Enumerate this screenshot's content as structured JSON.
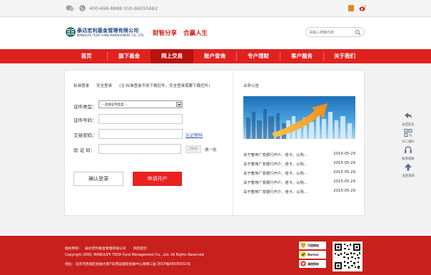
{
  "topbar": {
    "phone": "400-698-8888 010-66555662"
  },
  "header": {
    "logo_cn": "泰达宏利基金管理有限公司",
    "logo_en": "MANULIFE TEDA FUND MANAGEMENT CO., LTD.",
    "slogan_a": "财智分享",
    "slogan_b": "合赢人生",
    "search_placeholder": "请输入搜索内容"
  },
  "nav": {
    "items": [
      {
        "label": "首页"
      },
      {
        "label": "旗下基金"
      },
      {
        "label": "网上交易"
      },
      {
        "label": "账户查询"
      },
      {
        "label": "专户理财"
      },
      {
        "label": "客户服务"
      },
      {
        "label": "关于我们"
      }
    ],
    "active_index": 2
  },
  "login": {
    "tab_standard": "标准登录",
    "tab_secure": "安全登录",
    "note": "(注:标准登录不用下载控件，安全登录需要下载控件)",
    "id_type_label": "证件类型：",
    "id_type_value": "-- 选择证件类型 --",
    "id_number_label": "证件号码：",
    "password_label": "交易密码：",
    "forgot_label": "忘记密码",
    "captcha_label": "验  证 码：",
    "captcha_text": "7824",
    "captcha_refresh": "换一张",
    "confirm_button": "确认登录",
    "open_account_button": "申请开户"
  },
  "announcements": {
    "title": "业务公告",
    "items": [
      {
        "title": "关于暂停广发银行开户、增卡、认购...",
        "date": "2015-05-29"
      },
      {
        "title": "关于暂停广发银行开户、增卡、认购...",
        "date": "2015-05-29"
      },
      {
        "title": "关于暂停广发银行开户、增卡、认购...",
        "date": "2015-05-29"
      },
      {
        "title": "关于暂停广发银行开户、增卡、认购...",
        "date": "2015-05-29"
      },
      {
        "title": "关于暂停广发银行开户、增卡、认购...",
        "date": "2015-05-29"
      }
    ]
  },
  "float_toolbar": {
    "items": [
      {
        "label": "返回首页",
        "icon": "back-arrow-icon"
      },
      {
        "label": "扫二维码",
        "icon": "qrcode-icon"
      },
      {
        "label": "联系客服",
        "icon": "headset-icon"
      },
      {
        "label": "返回顶部",
        "icon": "arrow-up-icon"
      }
    ]
  },
  "footer": {
    "copyright_owner_label": "版权所有：",
    "copyright_owner": "泰达宏利基金管理有限公司",
    "risk_notice": "风险提示",
    "copyright_line": "Copyright 2000, MANULIFE TEDA Fund Management Co., Ltd. All Rights Reserved",
    "address_line": "地址：北京市西城区金融大街7号英蓝国际金融中心南楼三层  京ICP备06035032号",
    "badges": [
      {
        "label": "可信网站",
        "color": "#f0a020"
      },
      {
        "label": "Norton",
        "color": "#f5c400"
      },
      {
        "label": "诚信网站",
        "color": "#e53a2a"
      }
    ]
  },
  "colors": {
    "brand_red": "#e0221f",
    "nav_active": "#b8120f",
    "footer_red": "#c8201c",
    "link_blue": "#3355aa"
  }
}
